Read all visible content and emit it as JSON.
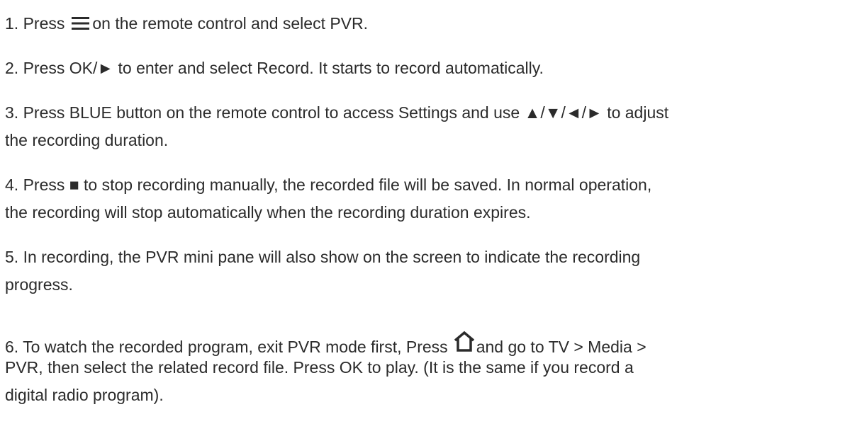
{
  "steps": [
    {
      "line1_before": "1. Press",
      "icon": "menu-icon",
      "line1_after": "on the remote control and select PVR."
    },
    {
      "line1": "2. Press OK/►  to enter and select Record. It starts to record automatically."
    },
    {
      "line1": "3. Press BLUE button on the remote control to access Settings and use  ▲/▼/◄/►  to adjust",
      "line2": "the recording duration."
    },
    {
      "line1": "4. Press ■ to stop recording manually, the recorded file will be saved. In normal operation,",
      "line2": "the recording will stop automatically when the recording duration expires."
    },
    {
      "line1": "5. In recording, the PVR mini pane will also show on the screen to indicate the recording",
      "line2": "progress."
    },
    {
      "line1_before": "6. To watch the recorded program, exit PVR mode first, Press",
      "icon": "home-icon",
      "line1_after": "and go to TV > Media >",
      "line2": "PVR, then select the related record file. Press OK to play. (It is the same if you record a",
      "line3": "digital radio program)."
    }
  ]
}
